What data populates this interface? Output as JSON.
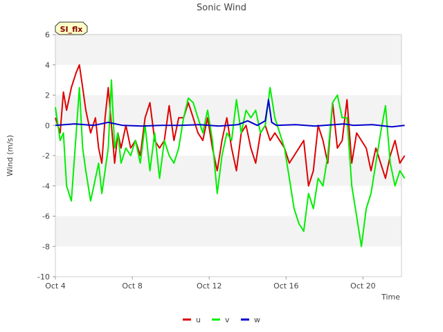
{
  "chart_data": {
    "type": "line",
    "title": "Sonic Wind",
    "badge": "SI_flx",
    "xlabel": "Time",
    "ylabel": "Wind (m/s)",
    "ylim": [
      -10,
      6
    ],
    "yticks": [
      -10,
      -8,
      -6,
      -4,
      -2,
      0,
      2,
      4,
      6
    ],
    "xlim": [
      "2023-10-04",
      "2023-10-22"
    ],
    "xticks": [
      {
        "date": "2023-10-04",
        "label": "Oct 4"
      },
      {
        "date": "2023-10-08",
        "label": "Oct 8"
      },
      {
        "date": "2023-10-12",
        "label": "Oct 12"
      },
      {
        "date": "2023-10-16",
        "label": "Oct 16"
      },
      {
        "date": "2023-10-20",
        "label": "Oct 20"
      }
    ],
    "grid": true,
    "legend": "bottom-center",
    "series": [
      {
        "name": "u",
        "color": "#dd0000",
        "points": [
          [
            "2023-10-04T00:00",
            0.5
          ],
          [
            "2023-10-04T06:00",
            -0.5
          ],
          [
            "2023-10-04T10:00",
            2.2
          ],
          [
            "2023-10-04T14:00",
            1.0
          ],
          [
            "2023-10-04T20:00",
            2.5
          ],
          [
            "2023-10-05T02:00",
            3.5
          ],
          [
            "2023-10-05T06:00",
            4.0
          ],
          [
            "2023-10-05T10:00",
            2.5
          ],
          [
            "2023-10-05T14:00",
            1.0
          ],
          [
            "2023-10-05T20:00",
            -0.5
          ],
          [
            "2023-10-06T02:00",
            0.5
          ],
          [
            "2023-10-06T06:00",
            -1.5
          ],
          [
            "2023-10-06T10:00",
            -2.5
          ],
          [
            "2023-10-06T14:00",
            0.5
          ],
          [
            "2023-10-06T18:00",
            2.5
          ],
          [
            "2023-10-06T22:00",
            0.0
          ],
          [
            "2023-10-07T02:00",
            -2.5
          ],
          [
            "2023-10-07T06:00",
            -0.5
          ],
          [
            "2023-10-07T10:00",
            -1.5
          ],
          [
            "2023-10-07T16:00",
            0.0
          ],
          [
            "2023-10-07T22:00",
            -1.5
          ],
          [
            "2023-10-08T04:00",
            -1.0
          ],
          [
            "2023-10-08T10:00",
            -2.0
          ],
          [
            "2023-10-08T16:00",
            0.5
          ],
          [
            "2023-10-08T22:00",
            1.5
          ],
          [
            "2023-10-09T04:00",
            -1.0
          ],
          [
            "2023-10-09T10:00",
            -1.5
          ],
          [
            "2023-10-09T16:00",
            -1.0
          ],
          [
            "2023-10-09T22:00",
            1.3
          ],
          [
            "2023-10-10T04:00",
            -1.0
          ],
          [
            "2023-10-10T10:00",
            0.5
          ],
          [
            "2023-10-10T16:00",
            0.5
          ],
          [
            "2023-10-10T22:00",
            1.5
          ],
          [
            "2023-10-11T04:00",
            0.5
          ],
          [
            "2023-10-11T10:00",
            -0.5
          ],
          [
            "2023-10-11T16:00",
            -1.0
          ],
          [
            "2023-10-11T22:00",
            0.5
          ],
          [
            "2023-10-12T04:00",
            -1.5
          ],
          [
            "2023-10-12T10:00",
            -3.0
          ],
          [
            "2023-10-12T16:00",
            -1.0
          ],
          [
            "2023-10-12T22:00",
            0.5
          ],
          [
            "2023-10-13T04:00",
            -1.5
          ],
          [
            "2023-10-13T10:00",
            -3.0
          ],
          [
            "2023-10-13T16:00",
            -0.5
          ],
          [
            "2023-10-13T22:00",
            0.0
          ],
          [
            "2023-10-14T04:00",
            -1.5
          ],
          [
            "2023-10-14T10:00",
            -2.5
          ],
          [
            "2023-10-14T16:00",
            -0.5
          ],
          [
            "2023-10-14T22:00",
            0.0
          ],
          [
            "2023-10-15T04:00",
            -1.0
          ],
          [
            "2023-10-15T10:00",
            -0.5
          ],
          [
            "2023-10-15T16:00",
            -1.0
          ],
          [
            "2023-10-15T22:00",
            -1.5
          ],
          [
            "2023-10-16T04:00",
            -2.5
          ],
          [
            "2023-10-16T10:00",
            -2.0
          ],
          [
            "2023-10-16T16:00",
            -1.5
          ],
          [
            "2023-10-16T22:00",
            -1.0
          ],
          [
            "2023-10-17T04:00",
            -4.0
          ],
          [
            "2023-10-17T10:00",
            -3.0
          ],
          [
            "2023-10-17T16:00",
            0.0
          ],
          [
            "2023-10-17T22:00",
            -1.0
          ],
          [
            "2023-10-18T04:00",
            -2.5
          ],
          [
            "2023-10-18T10:00",
            1.5
          ],
          [
            "2023-10-18T16:00",
            -1.5
          ],
          [
            "2023-10-18T22:00",
            -1.0
          ],
          [
            "2023-10-19T04:00",
            1.7
          ],
          [
            "2023-10-19T10:00",
            -2.5
          ],
          [
            "2023-10-19T16:00",
            -0.5
          ],
          [
            "2023-10-19T22:00",
            -1.0
          ],
          [
            "2023-10-20T04:00",
            -1.5
          ],
          [
            "2023-10-20T10:00",
            -3.0
          ],
          [
            "2023-10-20T16:00",
            -1.5
          ],
          [
            "2023-10-20T22:00",
            -2.5
          ],
          [
            "2023-10-21T04:00",
            -3.5
          ],
          [
            "2023-10-21T10:00",
            -2.0
          ],
          [
            "2023-10-21T16:00",
            -1.0
          ],
          [
            "2023-10-21T22:00",
            -2.5
          ],
          [
            "2023-10-22T04:00",
            -2.0
          ]
        ]
      },
      {
        "name": "v",
        "color": "#00ee00",
        "points": [
          [
            "2023-10-04T00:00",
            1.2
          ],
          [
            "2023-10-04T06:00",
            -1.0
          ],
          [
            "2023-10-04T10:00",
            -0.5
          ],
          [
            "2023-10-04T14:00",
            -4.0
          ],
          [
            "2023-10-04T20:00",
            -5.0
          ],
          [
            "2023-10-05T02:00",
            -0.5
          ],
          [
            "2023-10-05T06:00",
            2.5
          ],
          [
            "2023-10-05T10:00",
            -1.5
          ],
          [
            "2023-10-05T14:00",
            -3.0
          ],
          [
            "2023-10-05T20:00",
            -5.0
          ],
          [
            "2023-10-06T02:00",
            -3.5
          ],
          [
            "2023-10-06T06:00",
            -2.5
          ],
          [
            "2023-10-06T10:00",
            -4.5
          ],
          [
            "2023-10-06T14:00",
            -3.0
          ],
          [
            "2023-10-06T18:00",
            -1.5
          ],
          [
            "2023-10-06T22:00",
            3.0
          ],
          [
            "2023-10-07T02:00",
            -1.5
          ],
          [
            "2023-10-07T06:00",
            -0.5
          ],
          [
            "2023-10-07T10:00",
            -2.5
          ],
          [
            "2023-10-07T16:00",
            -1.5
          ],
          [
            "2023-10-07T22:00",
            -2.0
          ],
          [
            "2023-10-08T04:00",
            -1.0
          ],
          [
            "2023-10-08T10:00",
            -2.5
          ],
          [
            "2023-10-08T16:00",
            0.0
          ],
          [
            "2023-10-08T22:00",
            -3.0
          ],
          [
            "2023-10-09T04:00",
            -0.5
          ],
          [
            "2023-10-09T10:00",
            -3.5
          ],
          [
            "2023-10-09T16:00",
            -1.0
          ],
          [
            "2023-10-09T22:00",
            -2.0
          ],
          [
            "2023-10-10T04:00",
            -2.5
          ],
          [
            "2023-10-10T10:00",
            -1.5
          ],
          [
            "2023-10-10T16:00",
            0.5
          ],
          [
            "2023-10-10T22:00",
            1.8
          ],
          [
            "2023-10-11T04:00",
            1.5
          ],
          [
            "2023-10-11T10:00",
            0.5
          ],
          [
            "2023-10-11T16:00",
            -0.5
          ],
          [
            "2023-10-11T22:00",
            1.0
          ],
          [
            "2023-10-12T04:00",
            -1.0
          ],
          [
            "2023-10-12T10:00",
            -4.5
          ],
          [
            "2023-10-12T16:00",
            -2.0
          ],
          [
            "2023-10-12T22:00",
            -0.5
          ],
          [
            "2023-10-13T04:00",
            -1.0
          ],
          [
            "2023-10-13T10:00",
            1.7
          ],
          [
            "2023-10-13T16:00",
            -0.5
          ],
          [
            "2023-10-13T22:00",
            1.0
          ],
          [
            "2023-10-14T04:00",
            0.5
          ],
          [
            "2023-10-14T10:00",
            1.0
          ],
          [
            "2023-10-14T16:00",
            -0.5
          ],
          [
            "2023-10-14T22:00",
            0.0
          ],
          [
            "2023-10-15T04:00",
            2.5
          ],
          [
            "2023-10-15T10:00",
            0.5
          ],
          [
            "2023-10-15T16:00",
            -0.5
          ],
          [
            "2023-10-15T22:00",
            -1.5
          ],
          [
            "2023-10-16T04:00",
            -3.5
          ],
          [
            "2023-10-16T10:00",
            -5.5
          ],
          [
            "2023-10-16T16:00",
            -6.5
          ],
          [
            "2023-10-16T22:00",
            -7.0
          ],
          [
            "2023-10-17T04:00",
            -4.5
          ],
          [
            "2023-10-17T10:00",
            -5.5
          ],
          [
            "2023-10-17T16:00",
            -3.5
          ],
          [
            "2023-10-17T22:00",
            -4.0
          ],
          [
            "2023-10-18T04:00",
            -2.0
          ],
          [
            "2023-10-18T10:00",
            1.5
          ],
          [
            "2023-10-18T16:00",
            2.0
          ],
          [
            "2023-10-18T22:00",
            0.5
          ],
          [
            "2023-10-19T04:00",
            0.5
          ],
          [
            "2023-10-19T10:00",
            -4.0
          ],
          [
            "2023-10-19T16:00",
            -6.0
          ],
          [
            "2023-10-19T22:00",
            -8.0
          ],
          [
            "2023-10-20T04:00",
            -5.5
          ],
          [
            "2023-10-20T10:00",
            -4.5
          ],
          [
            "2023-10-20T16:00",
            -2.5
          ],
          [
            "2023-10-20T22:00",
            -0.5
          ],
          [
            "2023-10-21T04:00",
            1.3
          ],
          [
            "2023-10-21T10:00",
            -2.5
          ],
          [
            "2023-10-21T16:00",
            -4.0
          ],
          [
            "2023-10-21T22:00",
            -3.0
          ],
          [
            "2023-10-22T04:00",
            -3.5
          ]
        ]
      },
      {
        "name": "w",
        "color": "#0000cc",
        "points": [
          [
            "2023-10-04T00:00",
            0.0
          ],
          [
            "2023-10-05T00:00",
            0.1
          ],
          [
            "2023-10-06T00:00",
            0.0
          ],
          [
            "2023-10-06T18:00",
            0.2
          ],
          [
            "2023-10-07T12:00",
            0.0
          ],
          [
            "2023-10-08T12:00",
            -0.05
          ],
          [
            "2023-10-09T12:00",
            0.0
          ],
          [
            "2023-10-10T12:00",
            0.0
          ],
          [
            "2023-10-11T12:00",
            0.05
          ],
          [
            "2023-10-12T12:00",
            -0.05
          ],
          [
            "2023-10-13T12:00",
            0.05
          ],
          [
            "2023-10-14T00:00",
            0.3
          ],
          [
            "2023-10-14T12:00",
            0.0
          ],
          [
            "2023-10-14T22:00",
            0.3
          ],
          [
            "2023-10-15T02:00",
            1.7
          ],
          [
            "2023-10-15T06:00",
            0.2
          ],
          [
            "2023-10-15T12:00",
            0.0
          ],
          [
            "2023-10-16T12:00",
            0.05
          ],
          [
            "2023-10-17T12:00",
            -0.05
          ],
          [
            "2023-10-18T12:00",
            0.05
          ],
          [
            "2023-10-19T00:00",
            0.1
          ],
          [
            "2023-10-19T12:00",
            0.0
          ],
          [
            "2023-10-20T12:00",
            0.05
          ],
          [
            "2023-10-21T12:00",
            -0.1
          ],
          [
            "2023-10-22T04:00",
            0.0
          ]
        ]
      }
    ]
  }
}
